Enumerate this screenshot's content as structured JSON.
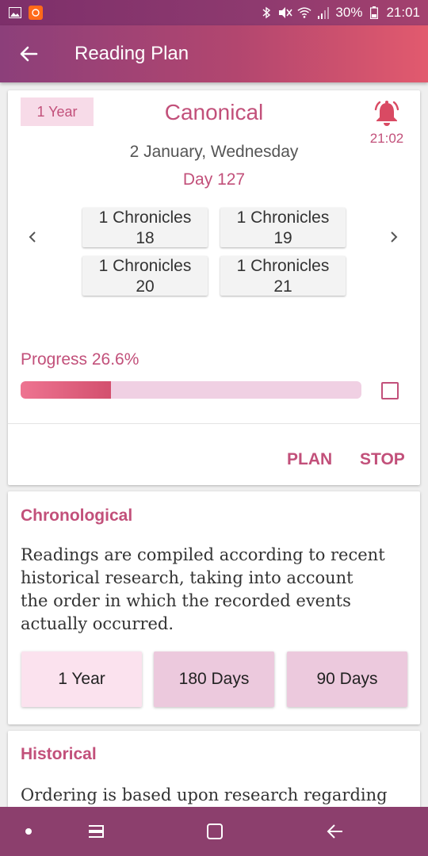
{
  "status_bar": {
    "battery": "30%",
    "time": "21:01",
    "icons": [
      "gallery-icon",
      "app-notification-icon",
      "bluetooth-icon",
      "mute-icon",
      "wifi-icon",
      "signal-icon",
      "battery-icon"
    ]
  },
  "app_bar": {
    "title": "Reading Plan",
    "back_icon": "arrow-left-icon"
  },
  "current_plan": {
    "duration_badge": "1 Year",
    "name": "Canonical",
    "reminder_time": "21:02",
    "date": "2 January, Wednesday",
    "day": "Day 127",
    "readings": [
      {
        "book": "1 Chronicles",
        "chapter": "18"
      },
      {
        "book": "1 Chronicles",
        "chapter": "19"
      },
      {
        "book": "1 Chronicles",
        "chapter": "20"
      },
      {
        "book": "1 Chronicles",
        "chapter": "21"
      }
    ],
    "progress_label": "Progress 26.6%",
    "progress_value": 0.266,
    "actions": {
      "plan": "PLAN",
      "stop": "STOP"
    }
  },
  "plans": [
    {
      "title": "Chronological",
      "description_lines": [
        "Readings are compiled according to recent",
        "historical research, taking into account",
        "the order in which the recorded events",
        "actually occurred."
      ],
      "options": [
        "1 Year",
        "180 Days",
        "90 Days"
      ]
    },
    {
      "title": "Historical",
      "description_lines": [
        "Ordering is based upon research regarding"
      ]
    }
  ],
  "colors": {
    "accent": "#c2507a",
    "app_bar_start": "#8c3f7a",
    "app_bar_end": "#e25a6e",
    "progress_fill": "#d3506e",
    "progress_track": "#f0d0e3",
    "nav_bar": "#8c3f6d"
  },
  "nav_bar": {
    "icons": [
      "dot-icon",
      "recent-apps-icon",
      "home-icon",
      "back-icon"
    ]
  }
}
